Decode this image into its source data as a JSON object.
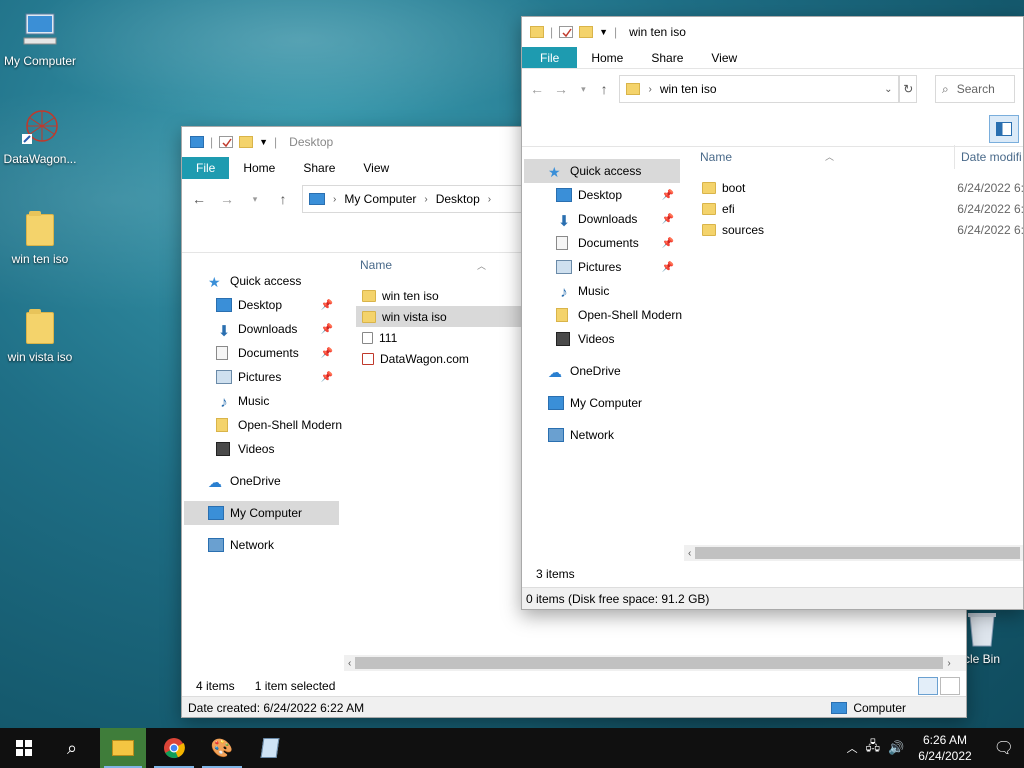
{
  "desktop": {
    "icons": [
      {
        "label": "My Computer"
      },
      {
        "label": "DataWagon..."
      },
      {
        "label": "win ten iso"
      },
      {
        "label": "win vista iso"
      },
      {
        "label": "ycle Bin"
      }
    ]
  },
  "win_desktop": {
    "title": "Desktop",
    "tabs": [
      "File",
      "Home",
      "Share",
      "View"
    ],
    "breadcrumb": [
      "My Computer",
      "Desktop"
    ],
    "nav": [
      {
        "label": "Quick access",
        "pinned": false
      },
      {
        "label": "Desktop",
        "pinned": true
      },
      {
        "label": "Downloads",
        "pinned": true
      },
      {
        "label": "Documents",
        "pinned": true
      },
      {
        "label": "Pictures",
        "pinned": true
      },
      {
        "label": "Music",
        "pinned": false
      },
      {
        "label": "Open-Shell Modern",
        "pinned": false
      },
      {
        "label": "Videos",
        "pinned": false
      },
      {
        "label": "OneDrive",
        "pinned": false
      },
      {
        "label": "My Computer",
        "pinned": false
      },
      {
        "label": "Network",
        "pinned": false
      }
    ],
    "column_name": "Name",
    "files": [
      "win ten iso",
      "win vista iso",
      "111",
      "DataWagon.com"
    ],
    "status_items": "4 items",
    "status_selected": "1 item selected",
    "details_bar": "Date created: 6/24/2022 6:22 AM",
    "details_location": "Computer"
  },
  "win_iso": {
    "title": "win ten iso",
    "tabs": [
      "File",
      "Home",
      "Share",
      "View"
    ],
    "breadcrumb": [
      "win ten iso"
    ],
    "search_placeholder": "Search",
    "nav": [
      {
        "label": "Quick access"
      },
      {
        "label": "Desktop"
      },
      {
        "label": "Downloads"
      },
      {
        "label": "Documents"
      },
      {
        "label": "Pictures"
      },
      {
        "label": "Music"
      },
      {
        "label": "Open-Shell Modern"
      },
      {
        "label": "Videos"
      },
      {
        "label": "OneDrive"
      },
      {
        "label": "My Computer"
      },
      {
        "label": "Network"
      }
    ],
    "column_name": "Name",
    "column_date": "Date modifi",
    "files": [
      {
        "name": "boot",
        "date": "6/24/2022 6:"
      },
      {
        "name": "efi",
        "date": "6/24/2022 6:"
      },
      {
        "name": "sources",
        "date": "6/24/2022 6:"
      }
    ],
    "status_items": "3 items",
    "details_bar": "0 items (Disk free space: 91.2 GB)"
  },
  "taskbar": {
    "time": "6:26 AM",
    "date": "6/24/2022"
  }
}
